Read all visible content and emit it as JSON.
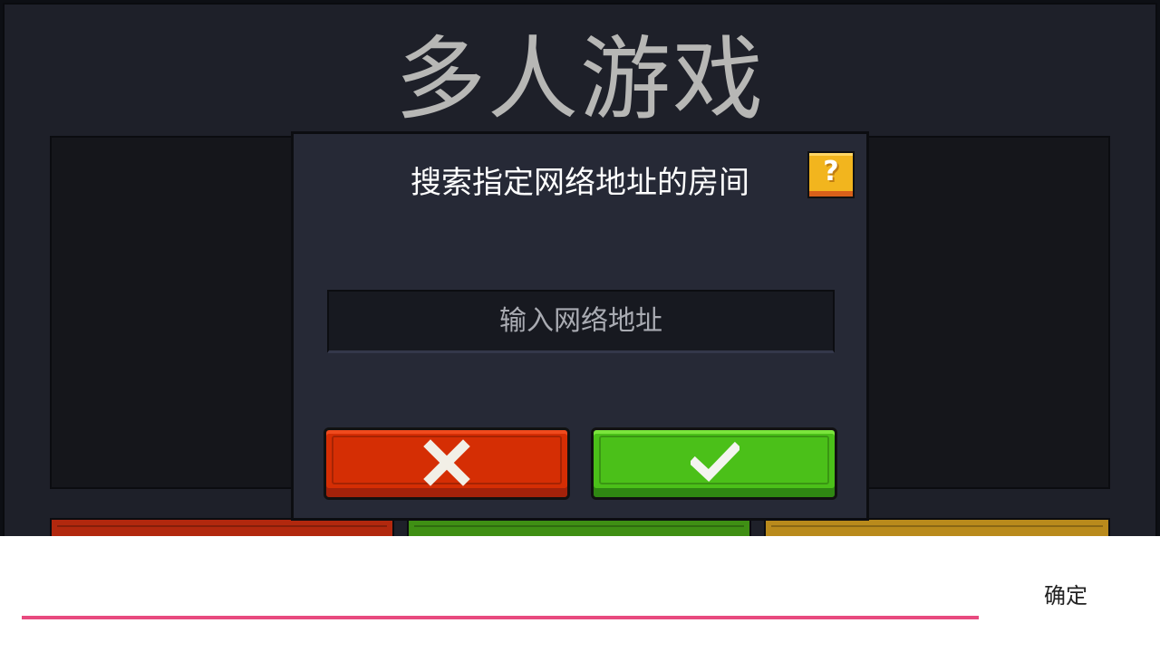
{
  "screen": {
    "title": "多人游戏"
  },
  "dialog": {
    "title": "搜索指定网络地址的房间",
    "help_icon": "question-mark-icon",
    "address_input": {
      "value": "",
      "placeholder": "输入网络地址"
    },
    "cancel_icon": "x-icon",
    "confirm_icon": "checkmark-icon"
  },
  "ime_bar": {
    "confirm_label": "确定"
  },
  "colors": {
    "cancel": "#d52e04",
    "confirm": "#4bc019",
    "help": "#f2b51e",
    "ime_underline": "#e84a7f"
  }
}
